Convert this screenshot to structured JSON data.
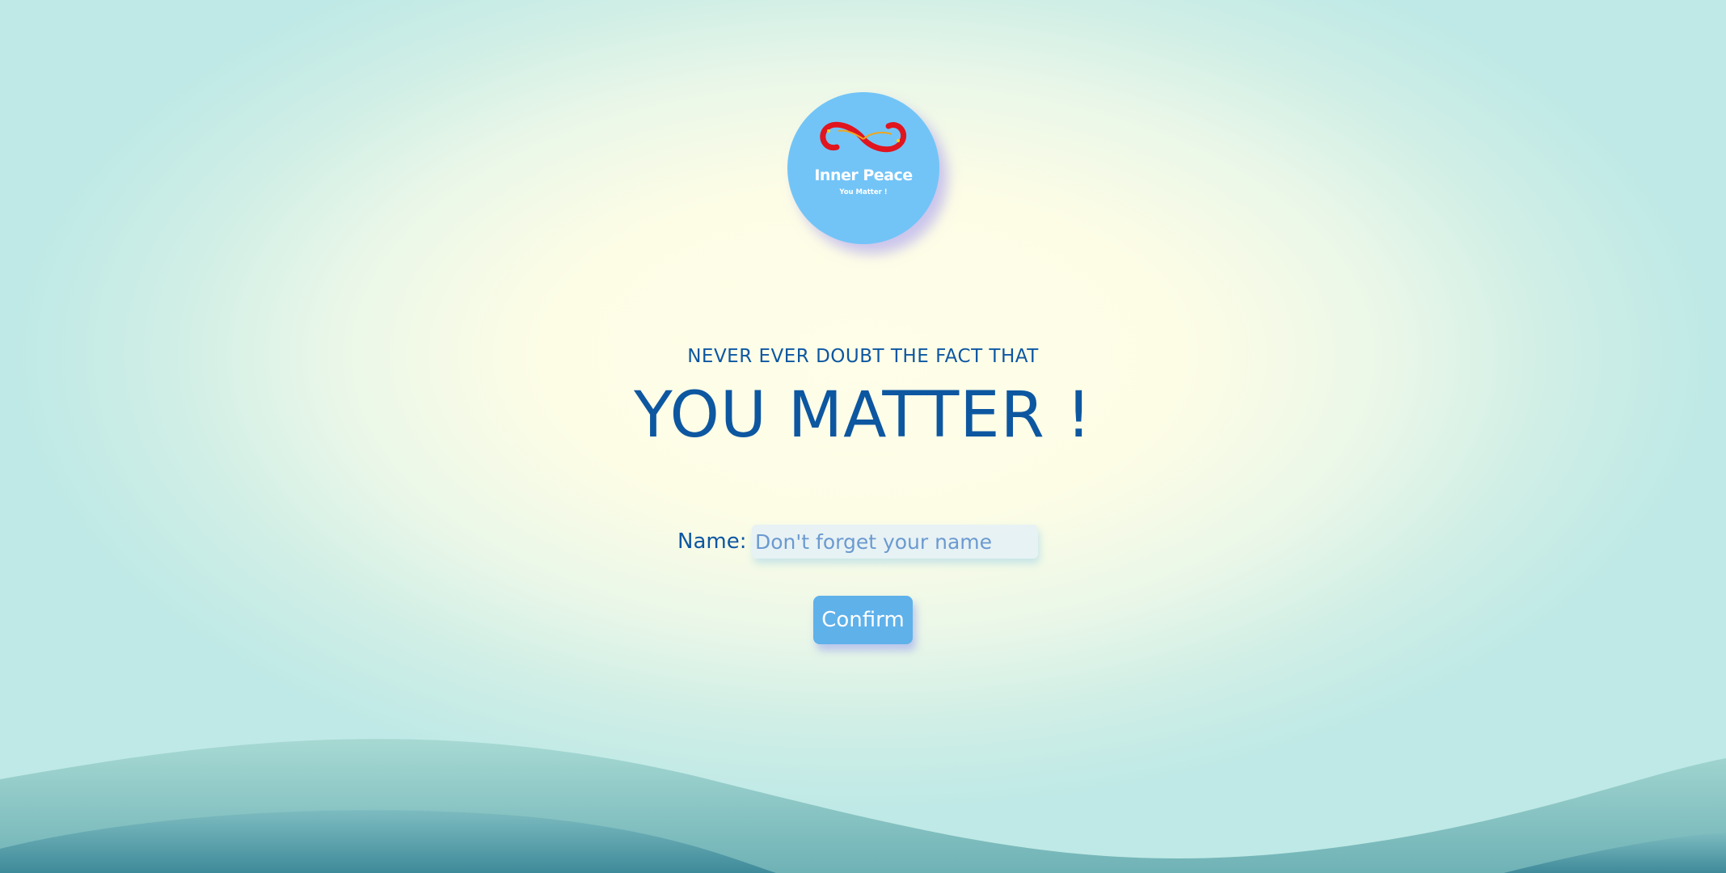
{
  "logo": {
    "title": "Inner Peace",
    "subtitle": "You Matter !",
    "icon": "infinity-icon",
    "background_color": "#72c4f7",
    "icon_color": "#e0151f"
  },
  "hero": {
    "subheading": "NEVER EVER DOUBT THE FACT THAT",
    "heading": "YOU MATTER !"
  },
  "form": {
    "name_label": "Name:",
    "name_placeholder": "Don't forget your name",
    "name_value": "",
    "confirm_label": "Confirm"
  },
  "colors": {
    "text_primary": "#0d57a1",
    "button_bg": "#5fb1ea",
    "wave_light": "#9fd3cf",
    "wave_dark": "#4e95a2"
  }
}
